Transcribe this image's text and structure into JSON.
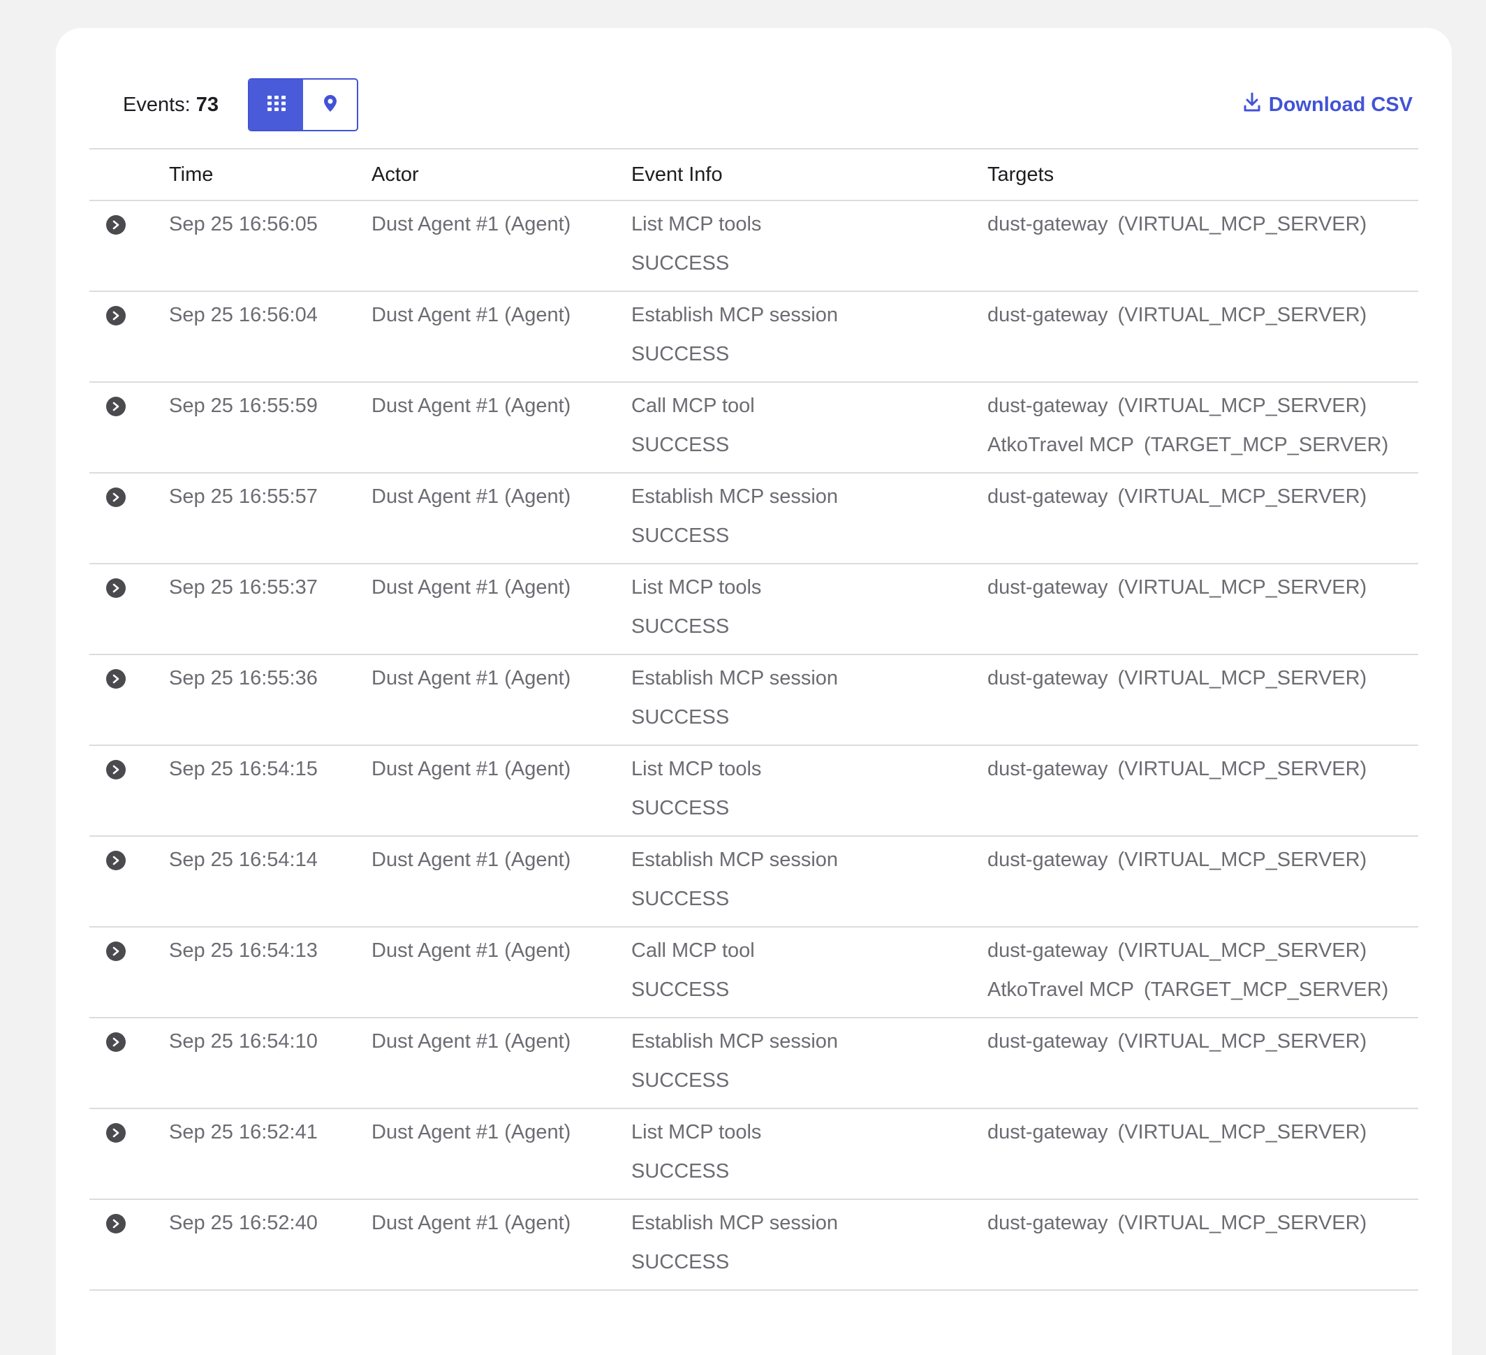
{
  "toolbar": {
    "events_label": "Events:",
    "events_count": "73",
    "grid_view_icon": "grid-icon",
    "map_view_icon": "map-pin-icon",
    "download_label": "Download CSV",
    "download_icon": "download-icon"
  },
  "colors": {
    "accent": "#4a5bd9",
    "text_primary": "#1d1d21",
    "text_secondary": "#6b6b72",
    "divider": "#dcdcdc",
    "page_bg": "#f2f2f2"
  },
  "table": {
    "columns": [
      "Time",
      "Actor",
      "Event Info",
      "Targets"
    ],
    "rows": [
      {
        "time": "Sep 25 16:56:05",
        "actor": "Dust Agent #1 (Agent)",
        "event": "List MCP tools",
        "status": "SUCCESS",
        "targets": [
          {
            "name": "dust-gateway",
            "type": "(VIRTUAL_MCP_SERVER)"
          }
        ]
      },
      {
        "time": "Sep 25 16:56:04",
        "actor": "Dust Agent #1 (Agent)",
        "event": "Establish MCP session",
        "status": "SUCCESS",
        "targets": [
          {
            "name": "dust-gateway",
            "type": "(VIRTUAL_MCP_SERVER)"
          }
        ]
      },
      {
        "time": "Sep 25 16:55:59",
        "actor": "Dust Agent #1 (Agent)",
        "event": "Call MCP tool",
        "status": "SUCCESS",
        "targets": [
          {
            "name": "dust-gateway",
            "type": "(VIRTUAL_MCP_SERVER)"
          },
          {
            "name": "AtkoTravel MCP",
            "type": "(TARGET_MCP_SERVER)"
          }
        ]
      },
      {
        "time": "Sep 25 16:55:57",
        "actor": "Dust Agent #1 (Agent)",
        "event": "Establish MCP session",
        "status": "SUCCESS",
        "targets": [
          {
            "name": "dust-gateway",
            "type": "(VIRTUAL_MCP_SERVER)"
          }
        ]
      },
      {
        "time": "Sep 25 16:55:37",
        "actor": "Dust Agent #1 (Agent)",
        "event": "List MCP tools",
        "status": "SUCCESS",
        "targets": [
          {
            "name": "dust-gateway",
            "type": "(VIRTUAL_MCP_SERVER)"
          }
        ]
      },
      {
        "time": "Sep 25 16:55:36",
        "actor": "Dust Agent #1 (Agent)",
        "event": "Establish MCP session",
        "status": "SUCCESS",
        "targets": [
          {
            "name": "dust-gateway",
            "type": "(VIRTUAL_MCP_SERVER)"
          }
        ]
      },
      {
        "time": "Sep 25 16:54:15",
        "actor": "Dust Agent #1 (Agent)",
        "event": "List MCP tools",
        "status": "SUCCESS",
        "targets": [
          {
            "name": "dust-gateway",
            "type": "(VIRTUAL_MCP_SERVER)"
          }
        ]
      },
      {
        "time": "Sep 25 16:54:14",
        "actor": "Dust Agent #1 (Agent)",
        "event": "Establish MCP session",
        "status": "SUCCESS",
        "targets": [
          {
            "name": "dust-gateway",
            "type": "(VIRTUAL_MCP_SERVER)"
          }
        ]
      },
      {
        "time": "Sep 25 16:54:13",
        "actor": "Dust Agent #1 (Agent)",
        "event": "Call MCP tool",
        "status": "SUCCESS",
        "targets": [
          {
            "name": "dust-gateway",
            "type": "(VIRTUAL_MCP_SERVER)"
          },
          {
            "name": "AtkoTravel MCP",
            "type": "(TARGET_MCP_SERVER)"
          }
        ]
      },
      {
        "time": "Sep 25 16:54:10",
        "actor": "Dust Agent #1 (Agent)",
        "event": "Establish MCP session",
        "status": "SUCCESS",
        "targets": [
          {
            "name": "dust-gateway",
            "type": "(VIRTUAL_MCP_SERVER)"
          }
        ]
      },
      {
        "time": "Sep 25 16:52:41",
        "actor": "Dust Agent #1 (Agent)",
        "event": "List MCP tools",
        "status": "SUCCESS",
        "targets": [
          {
            "name": "dust-gateway",
            "type": "(VIRTUAL_MCP_SERVER)"
          }
        ]
      },
      {
        "time": "Sep 25 16:52:40",
        "actor": "Dust Agent #1 (Agent)",
        "event": "Establish MCP session",
        "status": "SUCCESS",
        "targets": [
          {
            "name": "dust-gateway",
            "type": "(VIRTUAL_MCP_SERVER)"
          }
        ]
      }
    ]
  }
}
